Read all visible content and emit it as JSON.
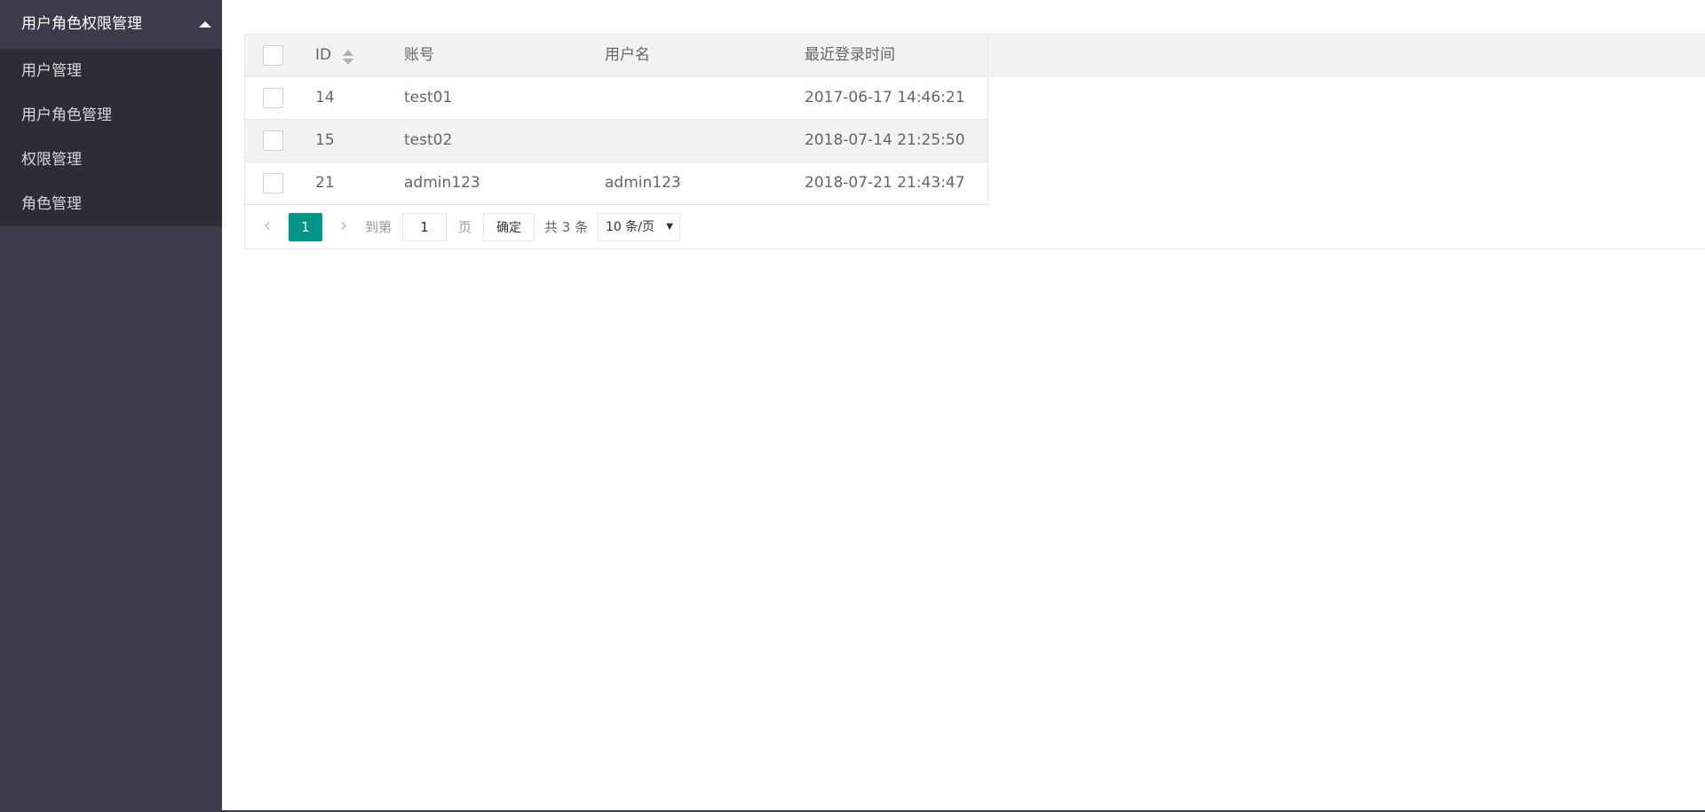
{
  "sidebar": {
    "title": "用户角色权限管理",
    "items": [
      {
        "label": "用户管理"
      },
      {
        "label": "用户角色管理"
      },
      {
        "label": "权限管理"
      },
      {
        "label": "角色管理"
      }
    ]
  },
  "table": {
    "headers": {
      "id": "ID",
      "account": "账号",
      "username": "用户名",
      "last_login": "最近登录时间"
    },
    "rows": [
      {
        "id": "14",
        "account": "test01",
        "username": "",
        "last_login": "2017-06-17 14:46:21"
      },
      {
        "id": "15",
        "account": "test02",
        "username": "",
        "last_login": "2018-07-14 21:25:50"
      },
      {
        "id": "21",
        "account": "admin123",
        "username": "admin123",
        "last_login": "2018-07-21 21:43:47"
      }
    ]
  },
  "pager": {
    "prev": "‹",
    "next": "›",
    "current_page": "1",
    "goto_label": "到第",
    "goto_value": "1",
    "page_suffix": "页",
    "confirm_label": "确定",
    "total_label": "共 3 条",
    "page_size": "10 条/页"
  },
  "colors": {
    "accent": "#009688",
    "sidebar_bg": "#393d49",
    "sidebar_child_bg": "#2b2e37"
  }
}
